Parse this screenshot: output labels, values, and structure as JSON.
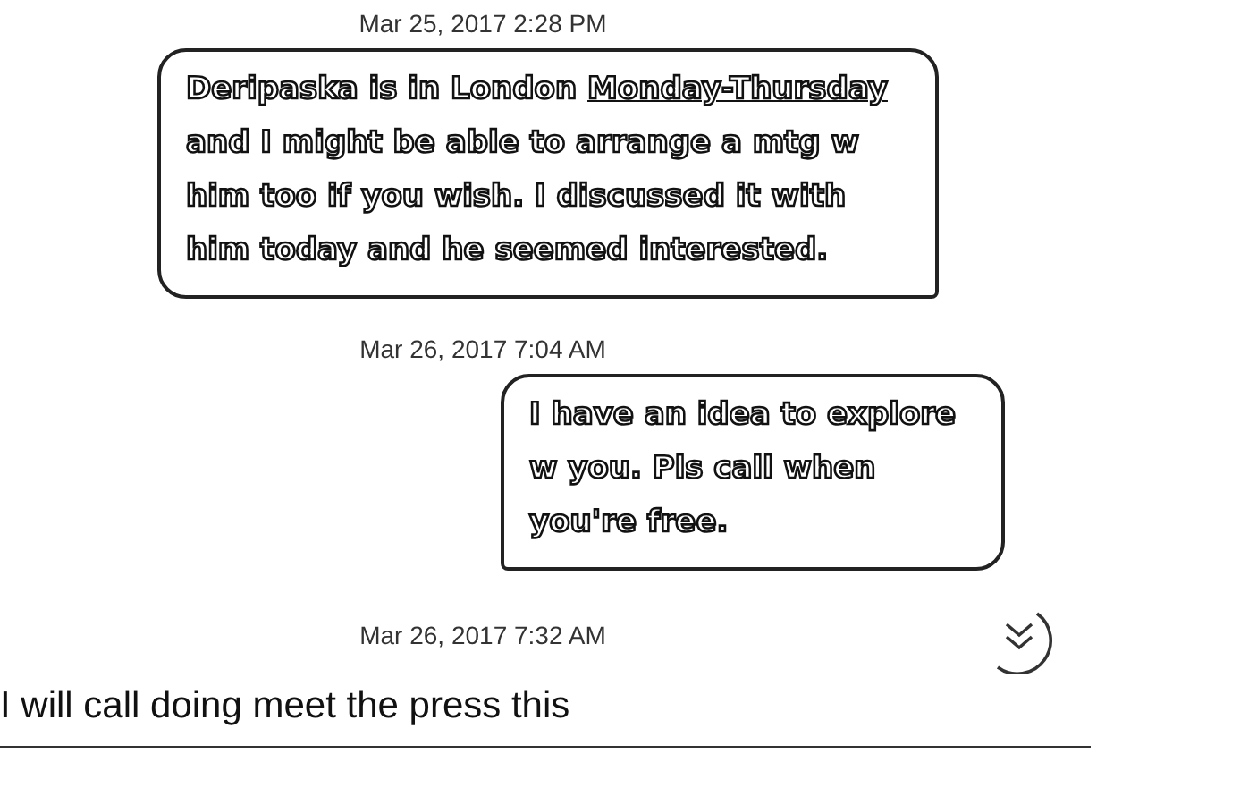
{
  "messages": [
    {
      "timestamp": "Mar 25, 2017 2:28 PM",
      "kind": "received",
      "parts": [
        {
          "text": "Deripaska is in London ",
          "link": false
        },
        {
          "text": "Monday-Thursday",
          "link": true
        },
        {
          "text": " and I might be able to arrange a mtg w him too if you wish. I discussed it with him today and he seemed interested.",
          "link": false
        }
      ]
    },
    {
      "timestamp": "Mar 26, 2017 7:04 AM",
      "kind": "sent",
      "parts": [
        {
          "text": "I have an idea to explore w you. Pls call when you're free.",
          "link": false
        }
      ]
    }
  ],
  "draft": {
    "timestamp": "Mar 26, 2017 7:32 AM",
    "text": "I will call doing meet the press this"
  }
}
